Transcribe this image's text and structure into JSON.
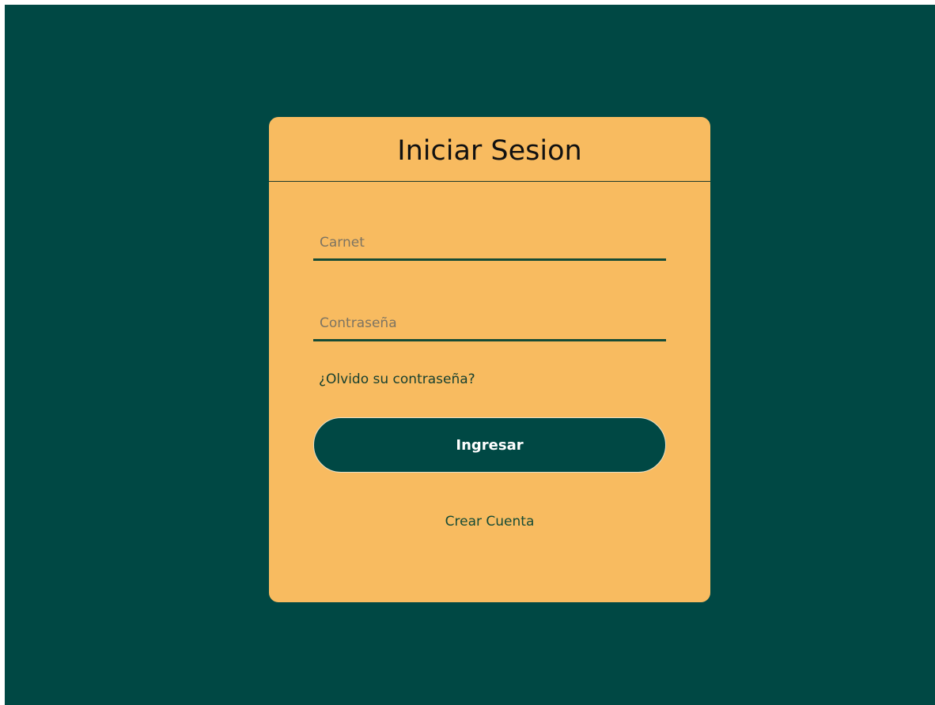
{
  "login": {
    "title": "Iniciar Sesion",
    "carnet_placeholder": "Carnet",
    "password_placeholder": "Contraseña",
    "forgot_label": "¿Olvido su contraseña?",
    "submit_label": "Ingresar",
    "create_label": "Crear Cuenta"
  },
  "colors": {
    "background": "#004844",
    "card": "#f8bb60",
    "button": "#004844",
    "accent": "#164b35"
  }
}
